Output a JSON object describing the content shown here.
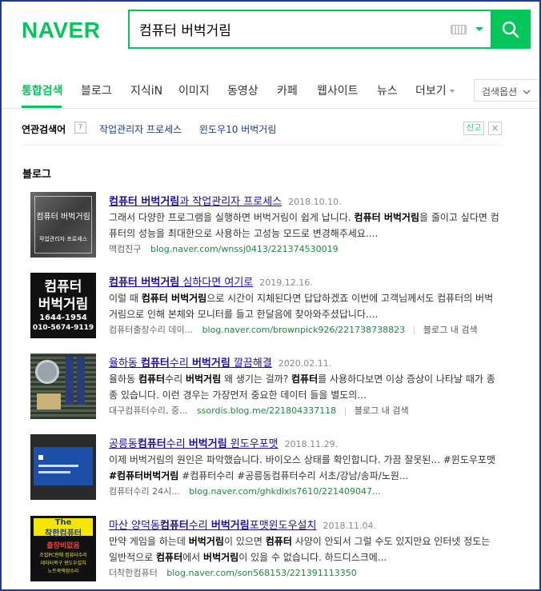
{
  "logo": "NAVER",
  "search": {
    "query": "컴퓨터 버벅거림"
  },
  "tabs": [
    {
      "label": "통합검색"
    },
    {
      "label": "블로그"
    },
    {
      "label": "지식iN"
    },
    {
      "label": "이미지"
    },
    {
      "label": "동영상"
    },
    {
      "label": "카페"
    },
    {
      "label": "웹사이트"
    },
    {
      "label": "뉴스"
    },
    {
      "label": "더보기"
    }
  ],
  "search_options": "검색옵션",
  "related": {
    "label": "연관검색어",
    "help": "?",
    "terms": [
      "작업관리자 프로세스",
      "윈도우10 버벅거림"
    ],
    "report": "신고",
    "close": "×"
  },
  "section_title": "블로그",
  "results": [
    {
      "title_parts": [
        [
          "b",
          "컴퓨터 버벅거림"
        ],
        [
          "t",
          "과 작업관리자 프로세스"
        ]
      ],
      "date": "2018.10.10.",
      "desc_parts": [
        [
          "t",
          "그래서 다양한 프로그램을 실행하면 버벅거림이 쉽게 납니다. "
        ],
        [
          "b",
          "컴퓨터 버벅거림"
        ],
        [
          "t",
          "을 줄이고 싶다면 컴퓨터의 성능을 최대한으로 사용하는 고성능 모드로 변경해주세요...."
        ]
      ],
      "author": "맥컴친구",
      "url": "blog.naver.com/wnssj0413/221374530019",
      "search_in_blog": "",
      "thumb_text": [
        "컴퓨터 버벅거림",
        "작업관리자 프로세스"
      ]
    },
    {
      "title_parts": [
        [
          "b",
          "컴퓨터 버벅거림"
        ],
        [
          "t",
          " 심하다면 여기로"
        ]
      ],
      "date": "2019.12.16.",
      "desc_parts": [
        [
          "t",
          "이럴 때 "
        ],
        [
          "b",
          "컴퓨터 버벅거림"
        ],
        [
          "t",
          "으로 시간이 지체된다면 답답하겠죠 이번에 고객님께서도 컴퓨터의 버벅거림으로 인해 본체와 모니터를 들고 한달음에 찾아와주셨답니다...."
        ]
      ],
      "author": "컴퓨터출장수리 데이...",
      "url": "blog.naver.com/brownpick926/221738738823",
      "search_in_blog": "블로그 내 검색",
      "thumb_text": [
        "컴퓨터",
        "버벅거림",
        "1644-1954",
        "010-5674-9119"
      ]
    },
    {
      "title_parts": [
        [
          "t",
          "율하동 "
        ],
        [
          "b",
          "컴퓨터"
        ],
        [
          "t",
          "수리 "
        ],
        [
          "b",
          "버벅거림"
        ],
        [
          "t",
          " 깔끔해결"
        ]
      ],
      "date": "2020.02.11.",
      "desc_parts": [
        [
          "t",
          "율하동 "
        ],
        [
          "b",
          "컴퓨터"
        ],
        [
          "t",
          "수리 "
        ],
        [
          "b",
          "버벅거림"
        ],
        [
          "t",
          " 왜 생기는 걸까? "
        ],
        [
          "b",
          "컴퓨터"
        ],
        [
          "t",
          "를 사용하다보면 이상 증상이 나타날 때가 종종 있습니다. 이런 경우는 가장먼저 중요한 데이터 들을 별도의..."
        ]
      ],
      "author": "대구컴퓨터수리, 중...",
      "url": "ssordis.blog.me/221804337118",
      "search_in_blog": "블로그 내 검색",
      "thumb_text": []
    },
    {
      "title_parts": [
        [
          "t",
          "공릉동"
        ],
        [
          "b",
          "컴퓨터"
        ],
        [
          "t",
          "수리 "
        ],
        [
          "b",
          "버벅거림"
        ],
        [
          "t",
          " 윈도우포맷"
        ]
      ],
      "date": "2018.11.29.",
      "desc_parts": [
        [
          "t",
          "이제 버벅거림의 원인은 파악했습니다. 바이오스 상태를 확인합니다. 가끔 잘못된... #윈도우포맷 "
        ],
        [
          "b",
          "#컴퓨터버벅거림"
        ],
        [
          "t",
          " #컴퓨터수리 #공릉동컴퓨터수리 서초/강남/송파/노원..."
        ]
      ],
      "author": "컴퓨터수리 24시...",
      "url": "blog.naver.com/ghkdlxls7610/221409047...",
      "search_in_blog": "",
      "thumb_text": []
    },
    {
      "title_parts": [
        [
          "t",
          "마산 양덕동"
        ],
        [
          "b",
          "컴퓨터"
        ],
        [
          "t",
          "수리 "
        ],
        [
          "b",
          "버벅거림"
        ],
        [
          "t",
          "포맷윈도우설치"
        ]
      ],
      "date": "2018.11.04.",
      "desc_parts": [
        [
          "t",
          "만약 게임을 하는데 "
        ],
        [
          "b",
          "버벅거림"
        ],
        [
          "t",
          "이 있으면 "
        ],
        [
          "b",
          "컴퓨터"
        ],
        [
          "t",
          " 사양이 안되서 그럴 수도 있지만요 인터넷 정도는 일반적으로 "
        ],
        [
          "b",
          "컴퓨터"
        ],
        [
          "t",
          "에서 "
        ],
        [
          "b",
          "버벅거림"
        ],
        [
          "t",
          "이 있을 수 없습니다. 하드디스크에..."
        ]
      ],
      "author": "더착한컴퓨터",
      "url": "blog.naver.com/son568153/221391113350",
      "search_in_blog": "",
      "thumb_text": [
        "The",
        "착한컴퓨터",
        "출장비없음",
        "조립PC판매 컴퓨터수리",
        "데이터복구 윈도우설치",
        "노트북액정수리"
      ]
    }
  ]
}
